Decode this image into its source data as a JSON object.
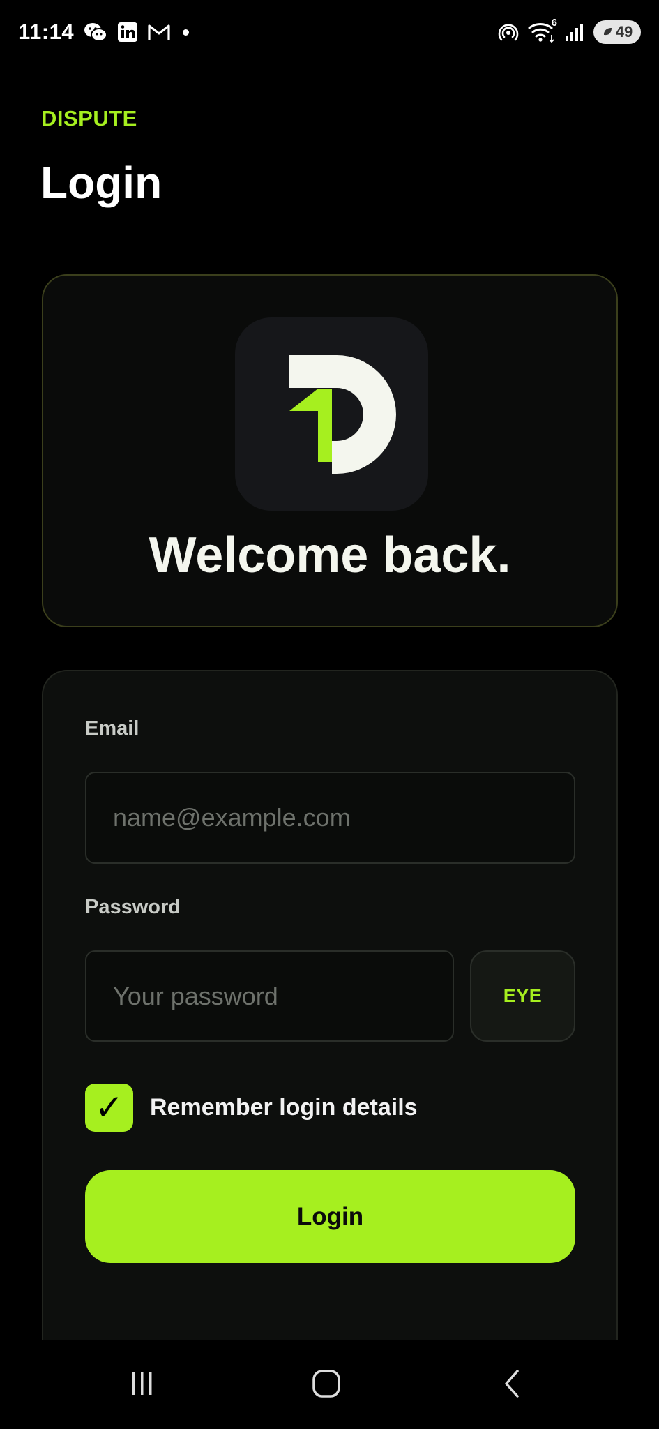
{
  "status_bar": {
    "time": "11:14",
    "left_icons": [
      "wechat-icon",
      "linkedin-icon",
      "gmail-icon",
      "notification-dot"
    ],
    "right_icons": [
      "hotspot-icon",
      "wifi-icon",
      "signal-icon"
    ],
    "wifi_badge": "6",
    "battery_level": "49"
  },
  "header": {
    "brand": "DISPUTE",
    "title": "Login"
  },
  "welcome_card": {
    "logo": "dispute-logo",
    "title": "Welcome back."
  },
  "form": {
    "email_label": "Email",
    "email_placeholder": "name@example.com",
    "email_value": "",
    "password_label": "Password",
    "password_placeholder": "Your password",
    "password_value": "",
    "eye_label": "EYE",
    "remember_checked": true,
    "remember_mark": "✓",
    "remember_label": "Remember login details",
    "login_label": "Login"
  },
  "nav_bar": {
    "items": [
      "recent-apps-icon",
      "home-icon",
      "back-icon"
    ]
  },
  "colors": {
    "accent": "#a6ef1f",
    "background": "#000000",
    "card": "#0d0f0d"
  }
}
